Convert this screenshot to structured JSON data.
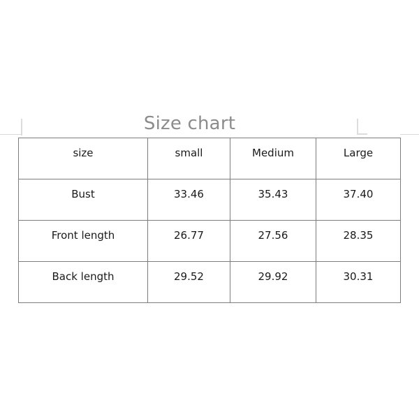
{
  "title": "Size chart",
  "colors": {
    "background": "#ffffff",
    "title_text": "#8c8c8c",
    "table_border": "#7d7d7d",
    "cell_text": "#1a1a1a",
    "crop_mark": "#dcdcdc"
  },
  "table": {
    "columns": [
      "size",
      "small",
      "Medium",
      "Large"
    ],
    "rows": [
      {
        "label": "Bust",
        "values": [
          "33.46",
          "35.43",
          "37.40"
        ]
      },
      {
        "label": "Front length",
        "values": [
          "26.77",
          "27.56",
          "28.35"
        ]
      },
      {
        "label": "Back length",
        "values": [
          "29.52",
          "29.92",
          "30.31"
        ]
      }
    ]
  },
  "chart_data": {
    "type": "table",
    "title": "Size chart",
    "xlabel": "",
    "ylabel": "",
    "categories": [
      "small",
      "Medium",
      "Large"
    ],
    "series": [
      {
        "name": "Bust",
        "values": [
          33.46,
          35.43,
          37.4
        ]
      },
      {
        "name": "Front length",
        "values": [
          26.77,
          27.56,
          28.35
        ]
      },
      {
        "name": "Back length",
        "values": [
          29.52,
          29.92,
          30.31
        ]
      }
    ],
    "header_row": [
      "size",
      "small",
      "Medium",
      "Large"
    ],
    "cells": [
      [
        "Bust",
        "33.46",
        "35.43",
        "37.40"
      ],
      [
        "Front length",
        "26.77",
        "27.56",
        "28.35"
      ],
      [
        "Back length",
        "29.52",
        "29.92",
        "30.31"
      ]
    ],
    "grid": true,
    "legend": "none"
  }
}
